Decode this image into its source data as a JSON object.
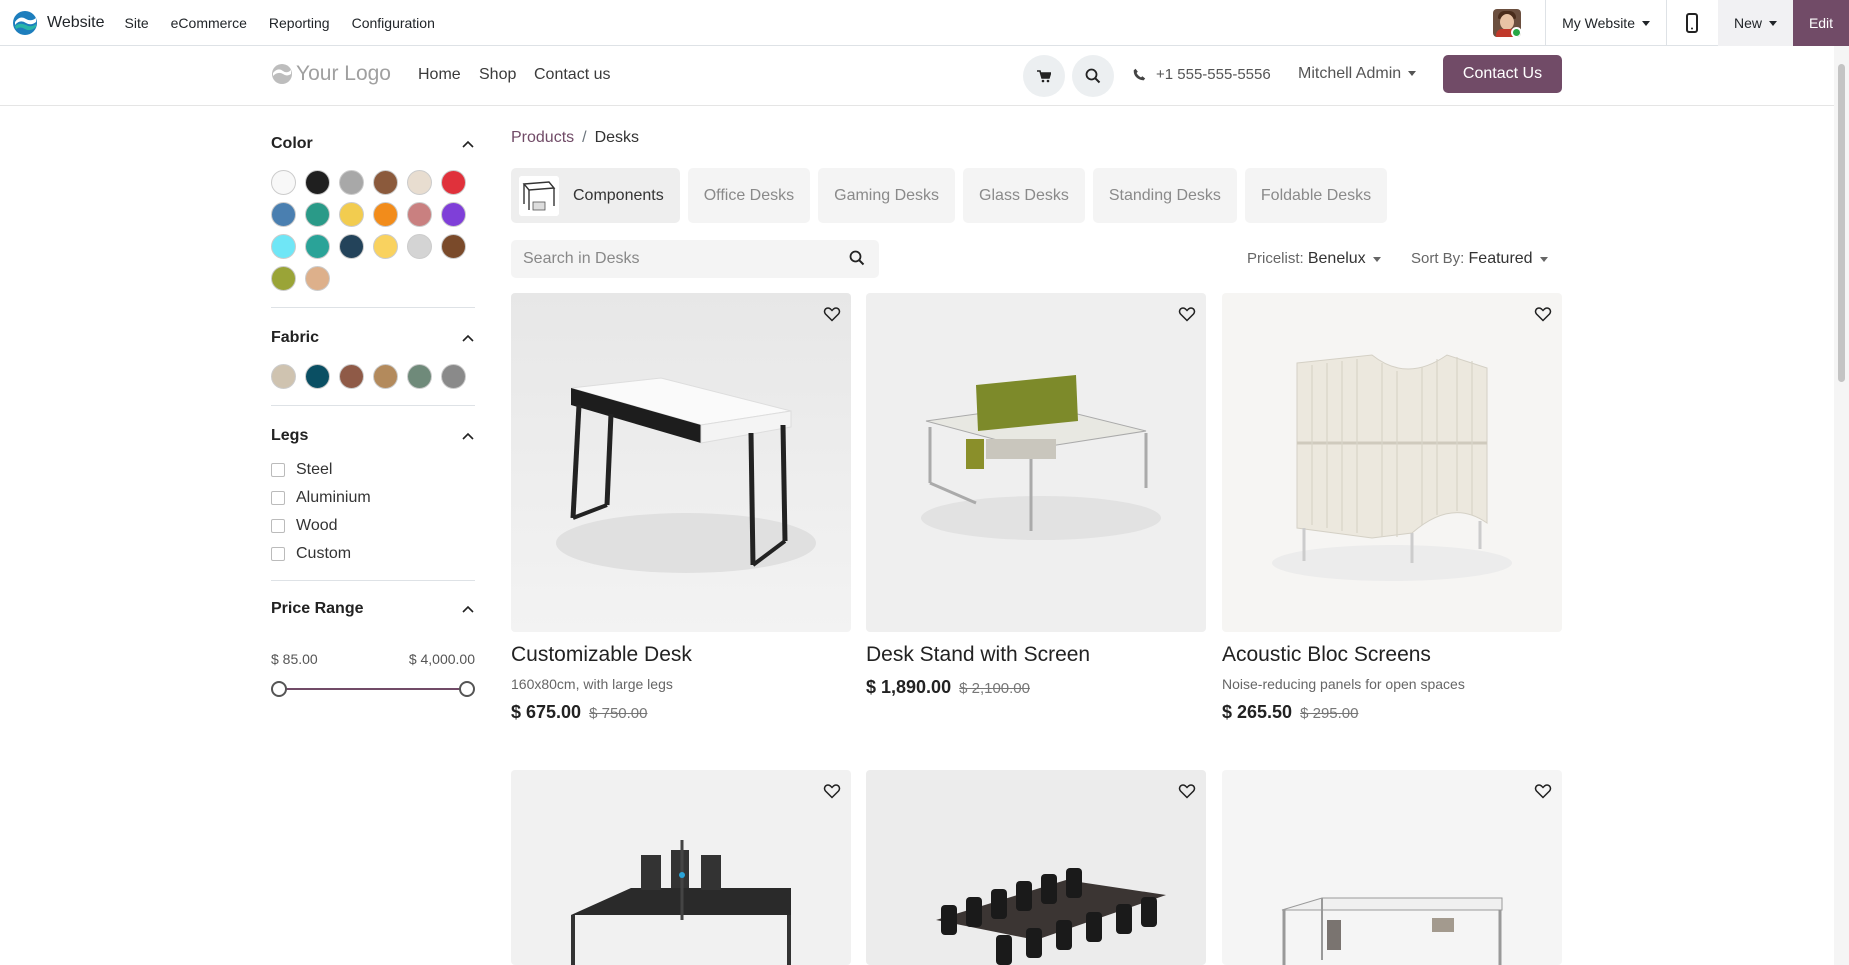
{
  "admin_bar": {
    "brand": "Website",
    "menus": [
      "Site",
      "eCommerce",
      "Reporting",
      "Configuration"
    ],
    "site_selector": "My Website",
    "new_label": "New",
    "edit_label": "Edit"
  },
  "header": {
    "logo_text": "Your Logo",
    "nav": [
      "Home",
      "Shop",
      "Contact us"
    ],
    "phone": "+1 555-555-5556",
    "user": "Mitchell Admin",
    "contact_button": "Contact Us"
  },
  "sidebar": {
    "color": {
      "title": "Color",
      "swatches": [
        "#f8f8f8",
        "#1f1f1f",
        "#a8a8a8",
        "#8b5a3c",
        "#e8ddd0",
        "#e0313b",
        "#4a7fb0",
        "#2a9a88",
        "#f2cc4f",
        "#f28c1b",
        "#c98080",
        "#7f3fd8",
        "#6fe6f6",
        "#2aa398",
        "#23435a",
        "#f9d25f",
        "#d4d4d4",
        "#7a4a2a",
        "#9aa437",
        "#ddb08b"
      ]
    },
    "fabric": {
      "title": "Fabric",
      "swatches": [
        "#cfc3b0",
        "#0a4f63",
        "#8f5a47",
        "#b38a5c",
        "#6f8a7a",
        "#8a8a8a"
      ]
    },
    "legs": {
      "title": "Legs",
      "options": [
        "Steel",
        "Aluminium",
        "Wood",
        "Custom"
      ]
    },
    "price": {
      "title": "Price Range",
      "min": "$ 85.00",
      "max": "$ 4,000.00"
    }
  },
  "breadcrumb": {
    "parent": "Products",
    "current": "Desks"
  },
  "categories": [
    "Components",
    "Office Desks",
    "Gaming Desks",
    "Glass Desks",
    "Standing Desks",
    "Foldable Desks"
  ],
  "search": {
    "placeholder": "Search in Desks"
  },
  "pricelist": {
    "label": "Pricelist:",
    "value": "Benelux"
  },
  "sort": {
    "label": "Sort By:",
    "value": "Featured"
  },
  "products": [
    {
      "name": "Customizable Desk",
      "desc": "160x80cm, with large legs",
      "price": "$ 675.00",
      "old_price": "$ 750.00"
    },
    {
      "name": "Desk Stand with Screen",
      "desc": "",
      "price": "$ 1,890.00",
      "old_price": "$ 2,100.00"
    },
    {
      "name": "Acoustic Bloc Screens",
      "desc": "Noise-reducing panels for open spaces",
      "price": "$ 265.50",
      "old_price": "$ 295.00"
    }
  ],
  "colors": {
    "accent": "#714b67",
    "slider_track": "#714b67"
  }
}
